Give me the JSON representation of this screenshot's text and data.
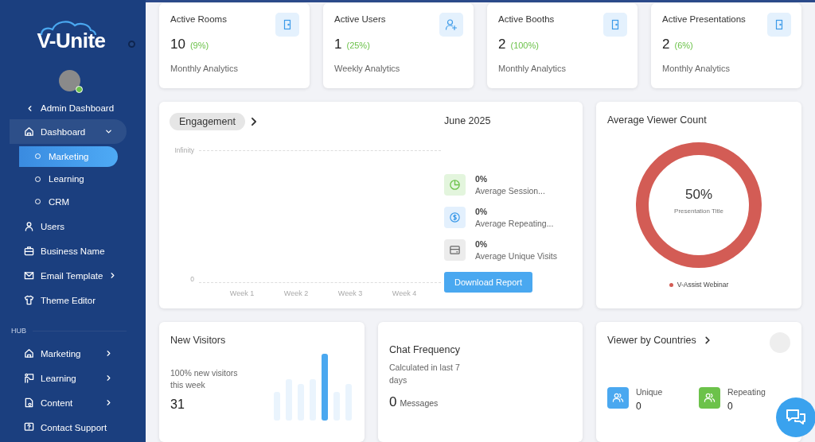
{
  "sidebar": {
    "logo": "V-Unite",
    "avatar": {
      "online": true
    },
    "back_link": "Admin Dashboard",
    "items": [
      {
        "label": "Dashboard",
        "selected": true,
        "expanded": true,
        "children": [
          {
            "label": "Marketing",
            "selected": true
          },
          {
            "label": "Learning",
            "selected": false
          },
          {
            "label": "CRM",
            "selected": false
          }
        ]
      },
      {
        "label": "Users",
        "selected": false
      },
      {
        "label": "Business Name",
        "selected": false
      },
      {
        "label": "Email Template",
        "selected": false,
        "expanded": false
      },
      {
        "label": "Theme Editor",
        "selected": false
      }
    ],
    "section": "HUB",
    "hub_items": [
      {
        "label": "Marketing",
        "selected": false,
        "expanded": false
      },
      {
        "label": "Learning",
        "selected": false,
        "expanded": false
      },
      {
        "label": "Content",
        "selected": false,
        "expanded": false
      },
      {
        "label": "Contact Support",
        "selected": false
      }
    ]
  },
  "stat_cards": [
    {
      "title": "Active Rooms",
      "value": "10",
      "change": "(9%)",
      "period": "Monthly Analytics"
    },
    {
      "title": "Active Users",
      "value": "1",
      "change": "(25%)",
      "period": "Weekly Analytics"
    },
    {
      "title": "Active Booths",
      "value": "2",
      "change": "(100%)",
      "period": "Monthly Analytics"
    },
    {
      "title": "Active Presentations",
      "value": "2",
      "change": "(6%)",
      "period": "Monthly Analytics"
    }
  ],
  "engagement": {
    "title": "Engagement",
    "y_labels": [
      "Infinity",
      "0"
    ],
    "x_labels": [
      "Week 1",
      "Week 2",
      "Week 3",
      "Week 4"
    ],
    "month": "June 2025",
    "metrics": [
      {
        "value": "0%",
        "label": "Average Session...",
        "color": "#e3f5dd"
      },
      {
        "value": "0%",
        "label": "Average Repeating...",
        "color": "#e3f0fd"
      },
      {
        "value": "0%",
        "label": "Average Unique Visits",
        "color": "#ececec"
      }
    ],
    "button": "Download Report"
  },
  "viewer_count": {
    "title": "Average Viewer Count",
    "center_value": "50%",
    "center_label": "Presentation Title",
    "legend": [
      {
        "label": "V-Assist Webinar",
        "color": "#d35c55"
      }
    ]
  },
  "new_visitors": {
    "title": "New Visitors",
    "note": "100% new visitors this week",
    "value": "31"
  },
  "chat_frequency": {
    "title": "Chat Frequency",
    "note": "Calculated in last 7 days",
    "value": "0",
    "unit": "Messages"
  },
  "countries": {
    "title": "Viewer by Countries",
    "stats": [
      {
        "label": "Unique",
        "value": "0",
        "color": "#4aa8f0"
      },
      {
        "label": "Repeating",
        "value": "0",
        "color": "#6cc24a"
      }
    ]
  }
}
